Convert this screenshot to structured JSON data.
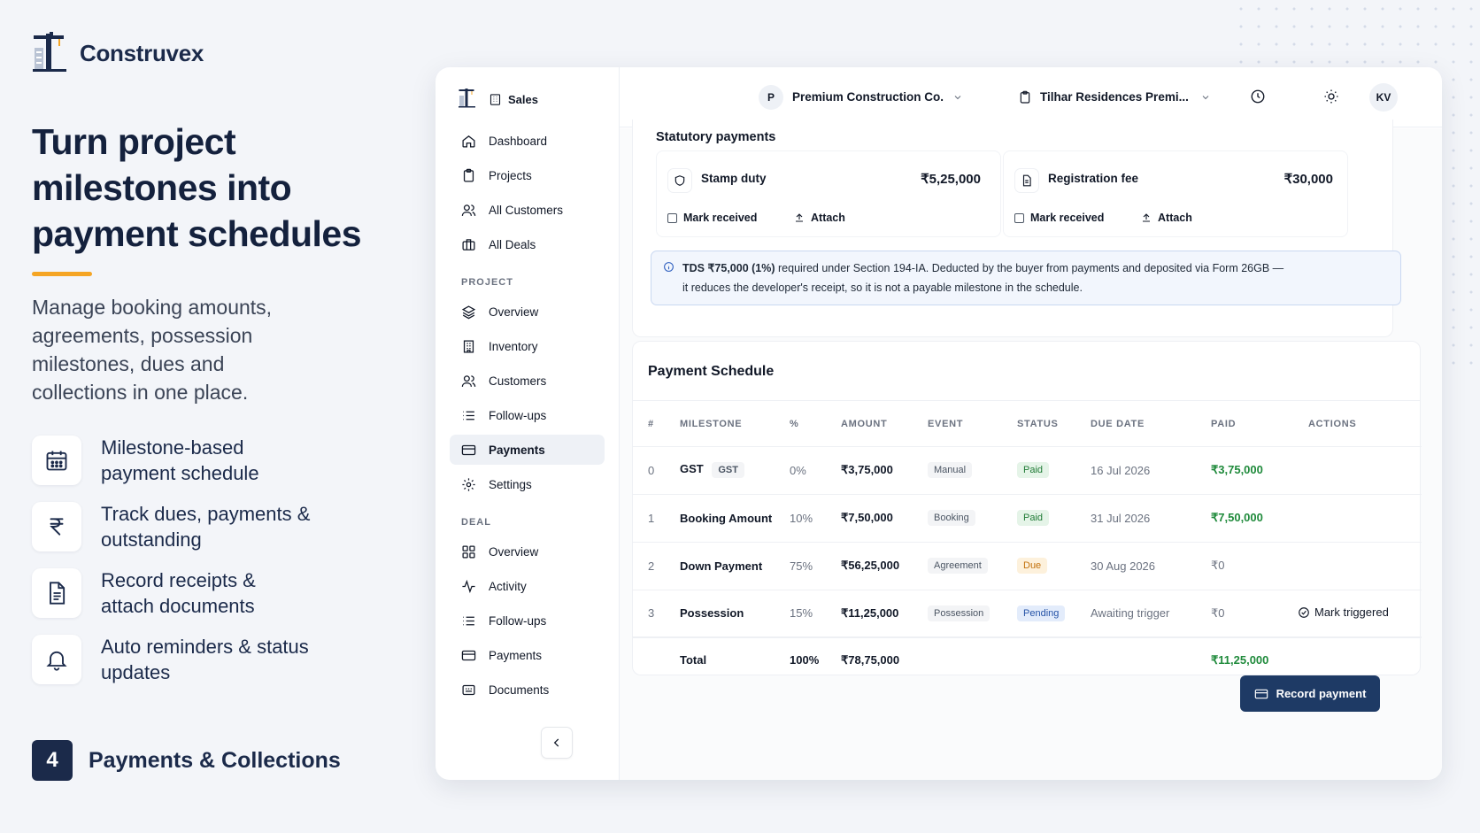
{
  "brand": {
    "name": "Construvex"
  },
  "hero": {
    "title": "Turn project milestones into payment schedules",
    "subtitle": "Manage booking amounts, agreements, possession milestones, dues and collections in one place."
  },
  "features": [
    {
      "icon": "calendar-icon",
      "text": "Milestone-based payment schedule"
    },
    {
      "icon": "rupee-icon",
      "text": "Track dues, payments & outstanding"
    },
    {
      "icon": "document-icon",
      "text": "Record receipts & attach documents"
    },
    {
      "icon": "bell-icon",
      "text": "Auto reminders & status updates"
    }
  ],
  "step": {
    "number": "4",
    "label": "Payments & Collections"
  },
  "app": {
    "module": "Sales",
    "sidebar": {
      "main": [
        {
          "icon": "home-icon",
          "label": "Dashboard"
        },
        {
          "icon": "clipboard-icon",
          "label": "Projects"
        },
        {
          "icon": "users-icon",
          "label": "All Customers"
        },
        {
          "icon": "briefcase-icon",
          "label": "All Deals"
        }
      ],
      "project_heading": "PROJECT",
      "project": [
        {
          "icon": "layers-icon",
          "label": "Overview"
        },
        {
          "icon": "building-icon",
          "label": "Inventory"
        },
        {
          "icon": "users-icon",
          "label": "Customers"
        },
        {
          "icon": "list-icon",
          "label": "Follow-ups"
        },
        {
          "icon": "credit-card-icon",
          "label": "Payments",
          "active": true
        },
        {
          "icon": "gear-icon",
          "label": "Settings"
        }
      ],
      "deal_heading": "DEAL",
      "deal": [
        {
          "icon": "grid-icon",
          "label": "Overview"
        },
        {
          "icon": "activity-icon",
          "label": "Activity"
        },
        {
          "icon": "list-icon",
          "label": "Follow-ups"
        },
        {
          "icon": "credit-card-icon",
          "label": "Payments"
        },
        {
          "icon": "documents-icon",
          "label": "Documents"
        }
      ]
    },
    "topbar": {
      "org_initial": "P",
      "org_name": "Premium Construction Co.",
      "project_name": "Tilhar Residences Premi...",
      "user_initials": "KV"
    },
    "statutory": {
      "title": "Statutory payments",
      "items": [
        {
          "icon": "shield-icon",
          "name": "Stamp duty",
          "amount": "₹5,25,000",
          "mark_label": "Mark received",
          "attach_label": "Attach"
        },
        {
          "icon": "file-icon",
          "name": "Registration fee",
          "amount": "₹30,000",
          "mark_label": "Mark received",
          "attach_label": "Attach"
        }
      ],
      "info_bold": "TDS ₹75,000 (1%)",
      "info_line1": " required under Section 194-IA. Deducted by the buyer from payments and deposited via Form 26GB —",
      "info_line2": "it reduces the developer's receipt, so it is not a payable milestone in the schedule."
    },
    "schedule": {
      "title": "Payment Schedule",
      "columns": [
        "#",
        "MILESTONE",
        "%",
        "AMOUNT",
        "EVENT",
        "STATUS",
        "DUE DATE",
        "PAID",
        "ACTIONS"
      ],
      "rows": [
        {
          "idx": "0",
          "milestone": "GST",
          "tag": "GST",
          "pct": "0%",
          "amount": "₹3,75,000",
          "event": "Manual",
          "status": "Paid",
          "status_kind": "paid",
          "due": "16 Jul 2026",
          "paid": "₹3,75,000",
          "action": ""
        },
        {
          "idx": "1",
          "milestone": "Booking Amount",
          "tag": "",
          "pct": "10%",
          "amount": "₹7,50,000",
          "event": "Booking",
          "status": "Paid",
          "status_kind": "paid",
          "due": "31 Jul 2026",
          "paid": "₹7,50,000",
          "action": ""
        },
        {
          "idx": "2",
          "milestone": "Down Payment",
          "tag": "",
          "pct": "75%",
          "amount": "₹56,25,000",
          "event": "Agreement",
          "status": "Due",
          "status_kind": "due",
          "due": "30 Aug 2026",
          "paid": "₹0",
          "action": ""
        },
        {
          "idx": "3",
          "milestone": "Possession",
          "tag": "",
          "pct": "15%",
          "amount": "₹11,25,000",
          "event": "Possession",
          "status": "Pending",
          "status_kind": "pend",
          "due": "Awaiting trigger",
          "paid": "₹0",
          "action": "Mark triggered"
        }
      ],
      "total": {
        "label": "Total",
        "pct": "100%",
        "amount": "₹78,75,000",
        "paid": "₹11,25,000"
      }
    },
    "record_button": "Record payment"
  }
}
